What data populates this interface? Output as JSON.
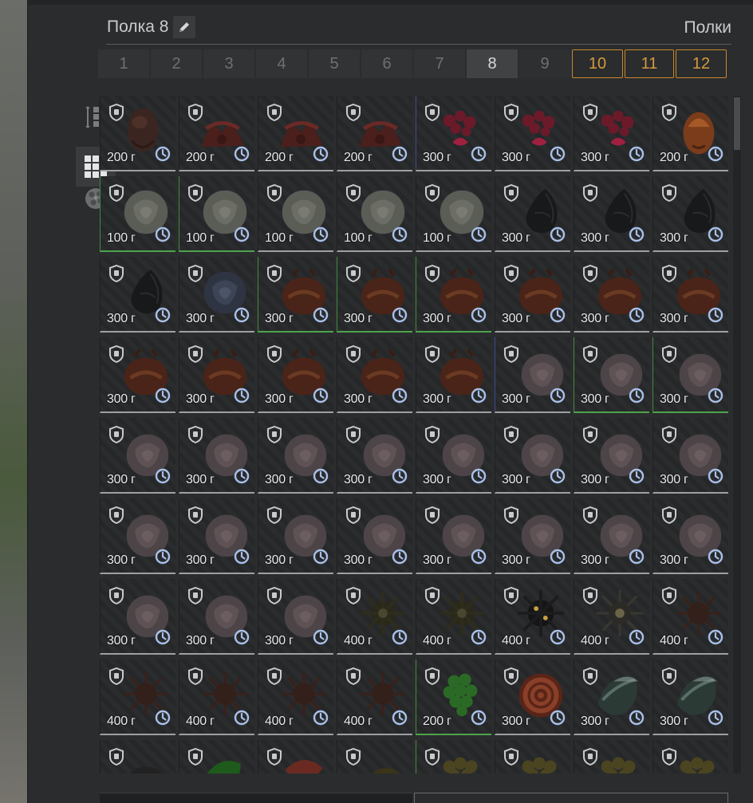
{
  "header": {
    "shelf_title": "Полка 8",
    "shelves_link": "Полки"
  },
  "tabs": [
    {
      "label": "1",
      "state": "normal"
    },
    {
      "label": "2",
      "state": "normal"
    },
    {
      "label": "3",
      "state": "normal"
    },
    {
      "label": "4",
      "state": "normal"
    },
    {
      "label": "5",
      "state": "normal"
    },
    {
      "label": "6",
      "state": "normal"
    },
    {
      "label": "7",
      "state": "normal"
    },
    {
      "label": "8",
      "state": "active"
    },
    {
      "label": "9",
      "state": "plain"
    },
    {
      "label": "10",
      "state": "gold"
    },
    {
      "label": "11",
      "state": "gold"
    },
    {
      "label": "12",
      "state": "gold"
    }
  ],
  "sidebar": {
    "buttons": [
      {
        "icon": "sort-icon",
        "active": false
      },
      {
        "icon": "grid-view-icon",
        "active": true
      },
      {
        "icon": "artifact-filter-icon",
        "active": false
      }
    ]
  },
  "colors": {
    "accent_gold": "#c9892c",
    "rarity_green": "#4da44a",
    "rarity_blue": "#3c4b8e",
    "timer_blue": "#a8c0e8"
  },
  "items": [
    {
      "weight": "200 г",
      "art": "egg-dark",
      "rarity": "n"
    },
    {
      "weight": "200 г",
      "art": "claw-red",
      "rarity": "n"
    },
    {
      "weight": "200 г",
      "art": "claw-red",
      "rarity": "n"
    },
    {
      "weight": "200 г",
      "art": "claw-red",
      "rarity": "n"
    },
    {
      "weight": "300 г",
      "art": "coral-pink",
      "rarity": "b"
    },
    {
      "weight": "300 г",
      "art": "coral-pink",
      "rarity": "n"
    },
    {
      "weight": "300 г",
      "art": "coral-pink",
      "rarity": "n"
    },
    {
      "weight": "200 г",
      "art": "egg-orange",
      "rarity": "n"
    },
    {
      "weight": "100 г",
      "art": "rose-grey",
      "rarity": "g"
    },
    {
      "weight": "100 г",
      "art": "rose-grey",
      "rarity": "g"
    },
    {
      "weight": "100 г",
      "art": "rose-grey",
      "rarity": "n"
    },
    {
      "weight": "100 г",
      "art": "rose-grey",
      "rarity": "n"
    },
    {
      "weight": "100 г",
      "art": "rose-grey",
      "rarity": "n"
    },
    {
      "weight": "300 г",
      "art": "drop-black",
      "rarity": "n"
    },
    {
      "weight": "300 г",
      "art": "drop-black",
      "rarity": "n"
    },
    {
      "weight": "300 г",
      "art": "drop-black",
      "rarity": "n"
    },
    {
      "weight": "300 г",
      "art": "drop-black",
      "rarity": "n"
    },
    {
      "weight": "300 г",
      "art": "rose-blue",
      "rarity": "n"
    },
    {
      "weight": "300 г",
      "art": "shell-brown",
      "rarity": "g"
    },
    {
      "weight": "300 г",
      "art": "shell-brown",
      "rarity": "g"
    },
    {
      "weight": "300 г",
      "art": "shell-brown",
      "rarity": "g"
    },
    {
      "weight": "300 г",
      "art": "shell-brown",
      "rarity": "n"
    },
    {
      "weight": "300 г",
      "art": "shell-brown",
      "rarity": "n"
    },
    {
      "weight": "300 г",
      "art": "shell-brown",
      "rarity": "n"
    },
    {
      "weight": "300 г",
      "art": "shell-brown",
      "rarity": "n"
    },
    {
      "weight": "300 г",
      "art": "shell-brown",
      "rarity": "n"
    },
    {
      "weight": "300 г",
      "art": "shell-brown",
      "rarity": "n"
    },
    {
      "weight": "300 г",
      "art": "shell-brown",
      "rarity": "n"
    },
    {
      "weight": "300 г",
      "art": "shell-brown",
      "rarity": "n"
    },
    {
      "weight": "300 г",
      "art": "rose-pale",
      "rarity": "b"
    },
    {
      "weight": "300 г",
      "art": "rose-pale",
      "rarity": "g"
    },
    {
      "weight": "300 г",
      "art": "rose-pale",
      "rarity": "g"
    },
    {
      "weight": "300 г",
      "art": "rose-pale",
      "rarity": "n"
    },
    {
      "weight": "300 г",
      "art": "rose-pale",
      "rarity": "n"
    },
    {
      "weight": "300 г",
      "art": "rose-pale",
      "rarity": "n"
    },
    {
      "weight": "300 г",
      "art": "rose-pale",
      "rarity": "n"
    },
    {
      "weight": "300 г",
      "art": "rose-pale",
      "rarity": "n"
    },
    {
      "weight": "300 г",
      "art": "rose-pale",
      "rarity": "n"
    },
    {
      "weight": "300 г",
      "art": "rose-pale",
      "rarity": "n"
    },
    {
      "weight": "300 г",
      "art": "rose-pale",
      "rarity": "n"
    },
    {
      "weight": "300 г",
      "art": "rose-pale",
      "rarity": "n"
    },
    {
      "weight": "300 г",
      "art": "rose-pale",
      "rarity": "n"
    },
    {
      "weight": "300 г",
      "art": "rose-pale",
      "rarity": "n"
    },
    {
      "weight": "300 г",
      "art": "rose-pale",
      "rarity": "n"
    },
    {
      "weight": "300 г",
      "art": "rose-pale",
      "rarity": "n"
    },
    {
      "weight": "300 г",
      "art": "rose-pale",
      "rarity": "n"
    },
    {
      "weight": "300 г",
      "art": "rose-pale",
      "rarity": "n"
    },
    {
      "weight": "300 г",
      "art": "rose-pale",
      "rarity": "n"
    },
    {
      "weight": "300 г",
      "art": "rose-pale",
      "rarity": "n"
    },
    {
      "weight": "300 г",
      "art": "rose-pale",
      "rarity": "n"
    },
    {
      "weight": "300 г",
      "art": "rose-pale",
      "rarity": "n"
    },
    {
      "weight": "400 г",
      "art": "spike-olive",
      "rarity": "n"
    },
    {
      "weight": "400 г",
      "art": "spike-olive",
      "rarity": "n"
    },
    {
      "weight": "400 г",
      "art": "spike-dark",
      "rarity": "n"
    },
    {
      "weight": "400 г",
      "art": "star-spiky",
      "rarity": "n"
    },
    {
      "weight": "400 г",
      "art": "star-brown",
      "rarity": "n"
    },
    {
      "weight": "400 г",
      "art": "star-brown",
      "rarity": "n"
    },
    {
      "weight": "400 г",
      "art": "star-brown",
      "rarity": "n"
    },
    {
      "weight": "400 г",
      "art": "star-brown",
      "rarity": "n"
    },
    {
      "weight": "400 г",
      "art": "star-brown",
      "rarity": "n"
    },
    {
      "weight": "200 г",
      "art": "grape-green",
      "rarity": "g"
    },
    {
      "weight": "300 г",
      "art": "spiral-red",
      "rarity": "n"
    },
    {
      "weight": "300 г",
      "art": "leaf-teal",
      "rarity": "n"
    },
    {
      "weight": "300 г",
      "art": "leaf-teal",
      "rarity": "n"
    },
    {
      "weight": "",
      "art": "lump-dark",
      "rarity": "n"
    },
    {
      "weight": "",
      "art": "leaf-green",
      "rarity": "n"
    },
    {
      "weight": "",
      "art": "petal-red",
      "rarity": "n"
    },
    {
      "weight": "",
      "art": "lump-olive",
      "rarity": "n"
    },
    {
      "weight": "",
      "art": "cluster-olive",
      "rarity": "g"
    },
    {
      "weight": "",
      "art": "cluster-olive",
      "rarity": "n"
    },
    {
      "weight": "",
      "art": "cluster-olive",
      "rarity": "n"
    },
    {
      "weight": "",
      "art": "cluster-olive",
      "rarity": "n"
    }
  ]
}
